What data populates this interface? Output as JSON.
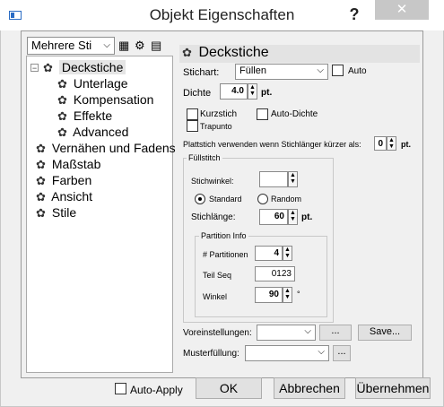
{
  "window": {
    "title": "Objekt Eigenschaften",
    "help": "?",
    "close": "✕"
  },
  "left": {
    "dropdown": "Mehrere Sti",
    "tree": [
      {
        "label": "Deckstiche",
        "selected": true
      },
      {
        "label": "Unterlage"
      },
      {
        "label": "Kompensation"
      },
      {
        "label": "Effekte"
      },
      {
        "label": "Advanced"
      },
      {
        "label": "Vernähen und Fadens"
      },
      {
        "label": "Maßstab"
      },
      {
        "label": "Farben"
      },
      {
        "label": "Ansicht"
      },
      {
        "label": "Stile"
      }
    ]
  },
  "right": {
    "title": "Deckstiche",
    "stichart_label": "Stichart:",
    "stichart_value": "Füllen",
    "auto_label": "Auto",
    "dichte_label": "Dichte",
    "dichte_value": "4.0",
    "dichte_unit": "pt.",
    "kurzstich_label": "Kurzstich",
    "trapunto_label": "Trapunto",
    "autodichte_label": "Auto-Dichte",
    "plattstich_label": "Plattstich verwenden wenn Stichlänger kürzer als:",
    "plattstich_value": "0",
    "plattstich_unit": "pt.",
    "fullstitch_label": "Füllstitch",
    "stichwinkel_label": "Stichwinkel:",
    "standard_label": "Standard",
    "random_label": "Random",
    "stichlange_label": "Stichlänge:",
    "stichlange_value": "60",
    "stichlange_unit": "pt.",
    "partition_label": "Partition Info",
    "partitionen_label": "# Partitionen",
    "partitionen_value": "4",
    "teilseq_label": "Teil Seq",
    "teilseq_value": "0123",
    "winkel_label": "Winkel",
    "winkel_value": "90",
    "winkel_unit": "°",
    "voreinstellungen_label": "Voreinstellungen:",
    "dots_label": "...",
    "save_label": "Save...",
    "musterfullung_label": "Musterfüllung:"
  },
  "bottom": {
    "autoapply_label": "Auto-Apply",
    "ok_label": "OK",
    "abbrechen_label": "Abbrechen",
    "ubernehmen_label": "Übernehmen"
  }
}
